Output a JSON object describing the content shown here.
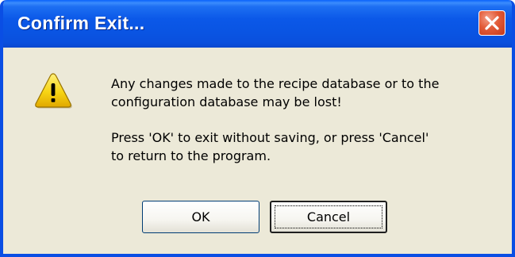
{
  "window": {
    "title": "Confirm Exit..."
  },
  "message": {
    "paragraph1": [
      "Any changes made to the recipe database or to the",
      "configuration database may be lost!"
    ],
    "paragraph2": [
      "Press 'OK' to exit without saving, or press 'Cancel'",
      "to return to the program."
    ]
  },
  "buttons": {
    "ok_label": "OK",
    "cancel_label": "Cancel"
  },
  "icons": {
    "message_icon": "warning-icon",
    "close": "close-icon"
  },
  "colors": {
    "titlebar": "#0a54e2",
    "dialog_background": "#ece9d8",
    "close_button": "#e25a37",
    "warning_yellow": "#f7d414"
  }
}
